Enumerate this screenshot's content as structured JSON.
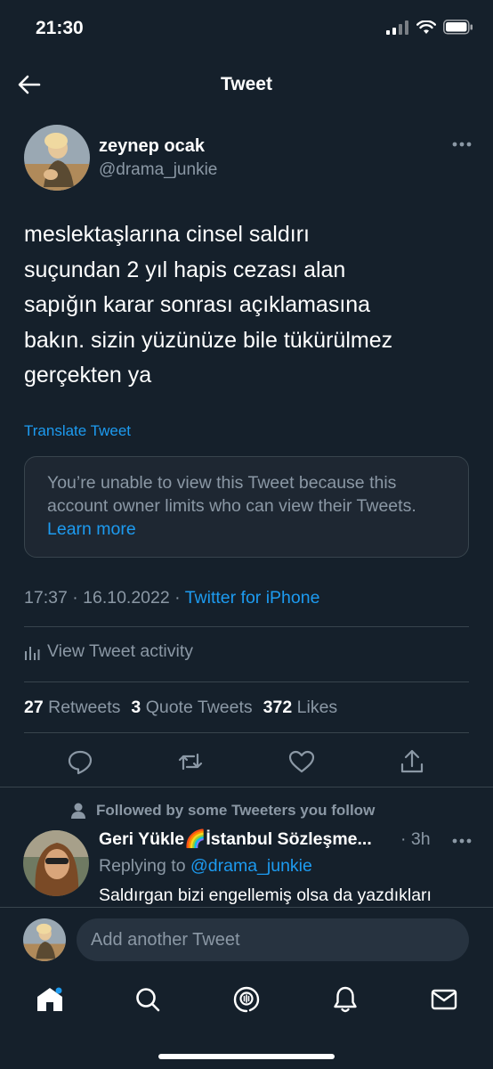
{
  "status_bar": {
    "time": "21:30"
  },
  "header": {
    "title": "Tweet"
  },
  "author": {
    "name": "zeynep ocak",
    "handle": "@drama_junkie"
  },
  "tweet": {
    "lines": [
      "meslektaşlarına cinsel saldırı",
      "suçundan 2 yıl hapis cezası alan",
      "sapığın karar sonrası açıklamasına",
      "bakın. sizin yüzünüze bile tükürülmez",
      "gerçekten ya"
    ],
    "translate_label": "Translate Tweet",
    "notice_text": "You’re unable to view this Tweet because this account owner limits who can view their Tweets.",
    "notice_link": "Learn more",
    "timestamp": "17:37 · 16.10.2022 · ",
    "source": "Twitter for iPhone",
    "activity_label": "View Tweet activity",
    "stats": {
      "retweets_count": "27",
      "retweets_label": "Retweets",
      "quotes_count": "3",
      "quotes_label": "Quote Tweets",
      "likes_count": "372",
      "likes_label": "Likes"
    }
  },
  "reply": {
    "context": "Followed by some Tweeters you follow",
    "name": "Geri Yükle🌈İstanbul Sözleşme...",
    "time": "· 3h",
    "replying_label": "Replying to ",
    "replying_handle": "@drama_junkie",
    "text": "Saldırgan bizi engellemiş olsa da yazdıkları"
  },
  "composer": {
    "placeholder": "Add another Tweet"
  },
  "colors": {
    "background": "#15202b",
    "accent": "#1d9bf0",
    "muted": "#8b98a5",
    "border": "#38444d"
  }
}
